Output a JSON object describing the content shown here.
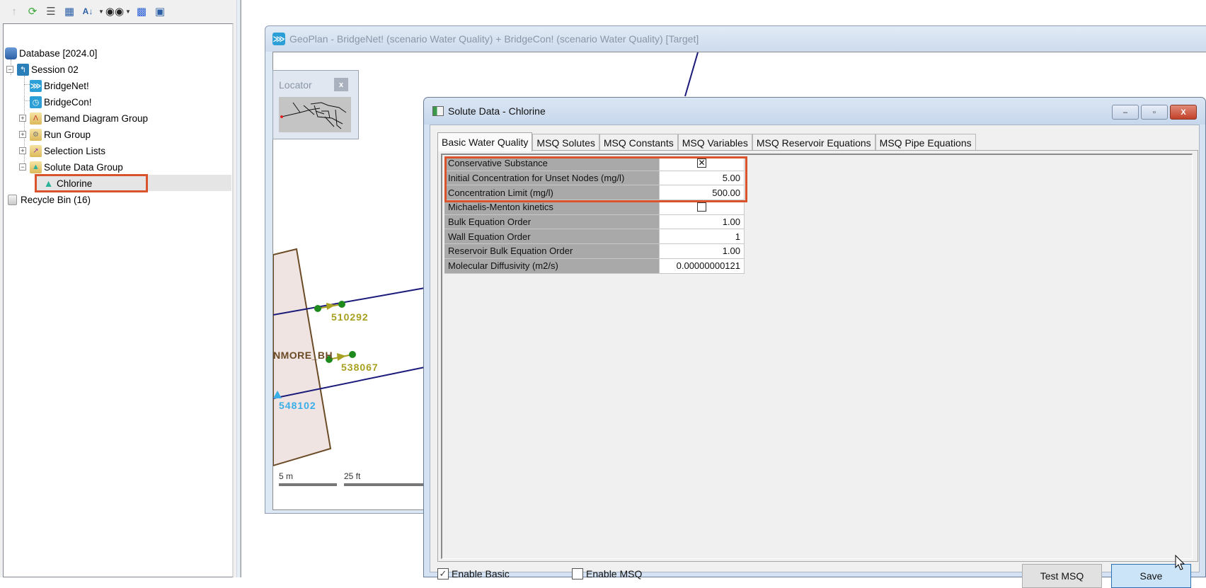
{
  "toolbar": {
    "icons": [
      "up-arrow-icon",
      "refresh-icon",
      "list-view-icon",
      "sort-grid-icon",
      "sort-az-icon",
      "binoculars-icon",
      "tree-structure-icon",
      "window-find-icon"
    ]
  },
  "tree": {
    "items": [
      {
        "label": "Database [2024.0]",
        "icon": "database-icon",
        "level": 0
      },
      {
        "label": "Session 02",
        "icon": "session-icon",
        "level": 0,
        "expanded": true
      },
      {
        "label": "BridgeNet!",
        "icon": "network-icon",
        "level": 1
      },
      {
        "label": "BridgeCon!",
        "icon": "control-icon",
        "level": 1
      },
      {
        "label": "Demand Diagram Group",
        "icon": "folder-icon",
        "level": 1,
        "expanded": false
      },
      {
        "label": "Run Group",
        "icon": "folder-icon",
        "level": 1,
        "expanded": false
      },
      {
        "label": "Selection Lists",
        "icon": "folder-icon",
        "level": 1,
        "expanded": false
      },
      {
        "label": "Solute Data Group",
        "icon": "folder-icon",
        "level": 1,
        "expanded": true
      },
      {
        "label": "Chlorine",
        "icon": "flask-icon",
        "level": 2,
        "selected": true
      },
      {
        "label": "Recycle Bin (16)",
        "icon": "recycle-bin-icon",
        "level": 0
      }
    ]
  },
  "geoplan": {
    "title": "GeoPlan - BridgeNet! (scenario Water Quality)  + BridgeCon! (scenario Water Quality)  [Target]",
    "locator": {
      "title": "Locator",
      "close": "x"
    },
    "map_labels": {
      "node_a": "510292",
      "node_b": "538067",
      "node_c": "548102",
      "area_label": "NMORE_BH"
    },
    "scale": {
      "metric": "5 m",
      "imperial": "25 ft"
    }
  },
  "dialog": {
    "title": "Solute Data - Chlorine",
    "window_buttons": {
      "minimize": "–",
      "maximize": "▫",
      "close": "X"
    },
    "tabs": [
      {
        "label": "Basic Water Quality",
        "active": true
      },
      {
        "label": "MSQ Solutes",
        "active": false
      },
      {
        "label": "MSQ Constants",
        "active": false
      },
      {
        "label": "MSQ Variables",
        "active": false
      },
      {
        "label": "MSQ Reservoir Equations",
        "active": false
      },
      {
        "label": "MSQ Pipe Equations",
        "active": false
      }
    ],
    "properties": [
      {
        "name": "Conservative Substance",
        "value": "☒",
        "type": "checkbox",
        "checked": true
      },
      {
        "name": "Initial Concentration for Unset Nodes (mg/l)",
        "value": "5.00",
        "type": "number"
      },
      {
        "name": "Concentration Limit (mg/l)",
        "value": "500.00",
        "type": "number"
      },
      {
        "name": "Michaelis-Menton kinetics",
        "value": "",
        "type": "checkbox",
        "checked": false
      },
      {
        "name": "Bulk Equation Order",
        "value": "1.00",
        "type": "number"
      },
      {
        "name": "Wall Equation Order",
        "value": "1",
        "type": "number"
      },
      {
        "name": "Reservoir Bulk Equation Order",
        "value": "1.00",
        "type": "number"
      },
      {
        "name": "Molecular Diffusivity (m2/s)",
        "value": "0.00000000121",
        "type": "number"
      }
    ],
    "enable_basic": {
      "label": "Enable Basic",
      "checked": true,
      "mark": "✓"
    },
    "enable_msq": {
      "label": "Enable MSQ",
      "checked": false,
      "mark": ""
    },
    "buttons": {
      "test_msq": "Test MSQ",
      "save": "Save"
    }
  },
  "colors": {
    "highlight": "#d9532c",
    "pipe": "#1a1a7a",
    "node": "#1e8a1e",
    "node_label": "#a8a020",
    "reservoir_label": "#3aaee8",
    "area_border": "#6b4a26"
  }
}
